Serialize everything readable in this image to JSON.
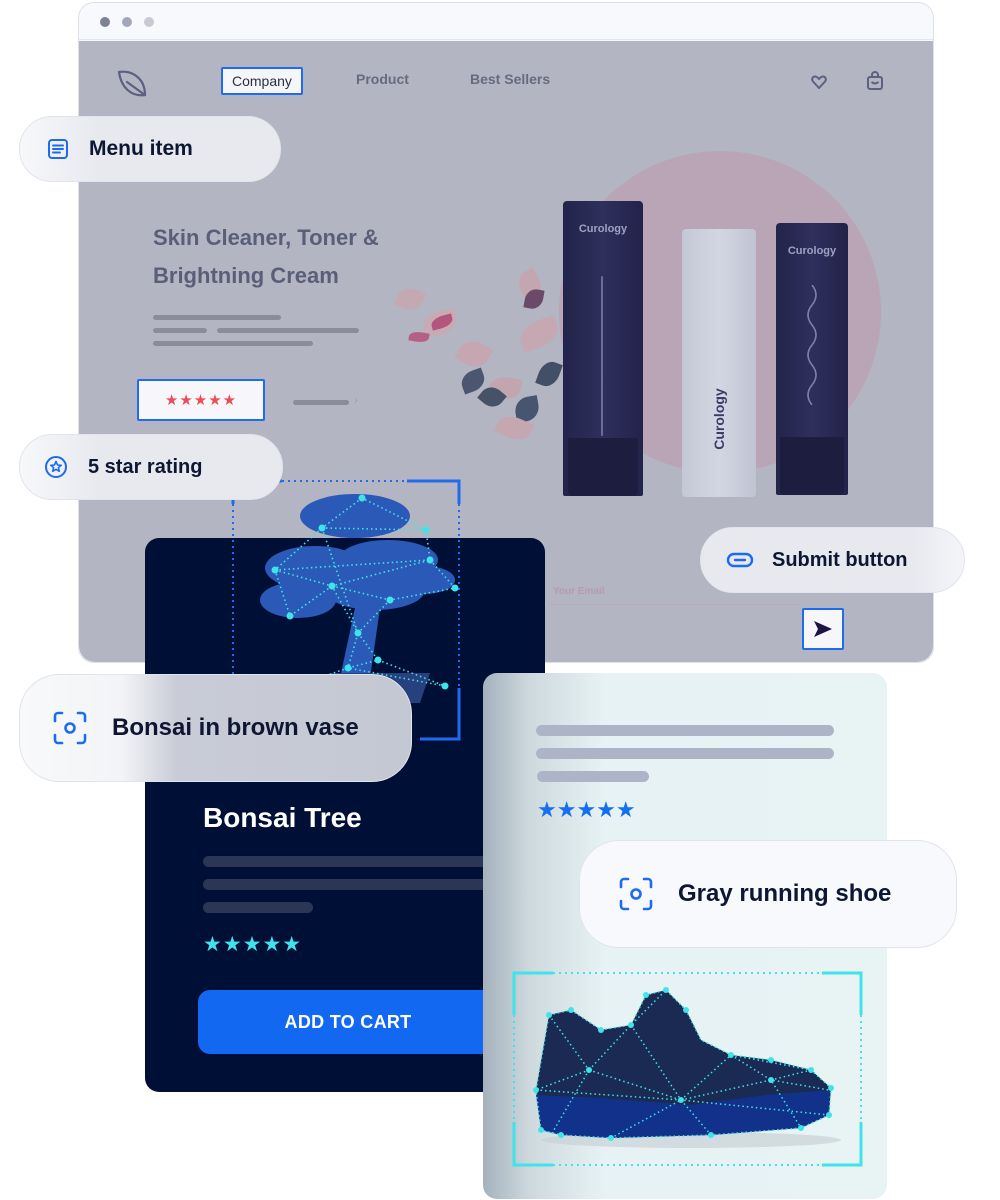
{
  "browser": {
    "window_controls": [
      "close",
      "minimize",
      "maximize"
    ]
  },
  "site": {
    "logo_icon": "leaf-icon",
    "nav": {
      "items": [
        {
          "label": "Company",
          "highlighted": true
        },
        {
          "label": "Product",
          "highlighted": false
        },
        {
          "label": "Best Sellers",
          "highlighted": false
        }
      ]
    },
    "header_icons": [
      "heart-icon",
      "shopping-bag-icon"
    ],
    "hero": {
      "title": "Skin Cleaner, Toner & Brightning Cream",
      "rating_stars": "★★★★★",
      "rating_value": 5,
      "rating_max": 5,
      "link_chevron": "›",
      "products": [
        {
          "brand": "Curology",
          "type": "tube"
        },
        {
          "brand": "Curology",
          "type": "bottle"
        },
        {
          "brand": "Curology",
          "type": "tube"
        }
      ]
    },
    "newsletter": {
      "email_placeholder": "Your Email",
      "submit_icon": "send-arrow-icon"
    }
  },
  "labels": {
    "menu_item": {
      "text": "Menu item",
      "icon": "list-icon"
    },
    "star_rating": {
      "text": "5 star rating",
      "icon": "star-circle-icon"
    },
    "submit_button": {
      "text": "Submit button",
      "icon": "button-icon"
    },
    "bonsai": {
      "text": "Bonsai in brown vase",
      "icon": "focus-scan-icon"
    },
    "shoe": {
      "text": "Gray running shoe",
      "icon": "focus-scan-icon"
    }
  },
  "bonsai_card": {
    "title": "Bonsai Tree",
    "stars": "★★★★★",
    "rating_value": 5,
    "rating_max": 5,
    "cta": "ADD TO CART"
  },
  "shoe_card": {
    "stars": "★★★★★",
    "rating_value": 5,
    "rating_max": 5
  },
  "colors": {
    "accent_blue": "#1f6bf0",
    "cta_blue": "#1368f2",
    "card_navy": "#000f36",
    "detect_cyan": "#3fe4ea",
    "rating_red": "#ef4a57"
  }
}
